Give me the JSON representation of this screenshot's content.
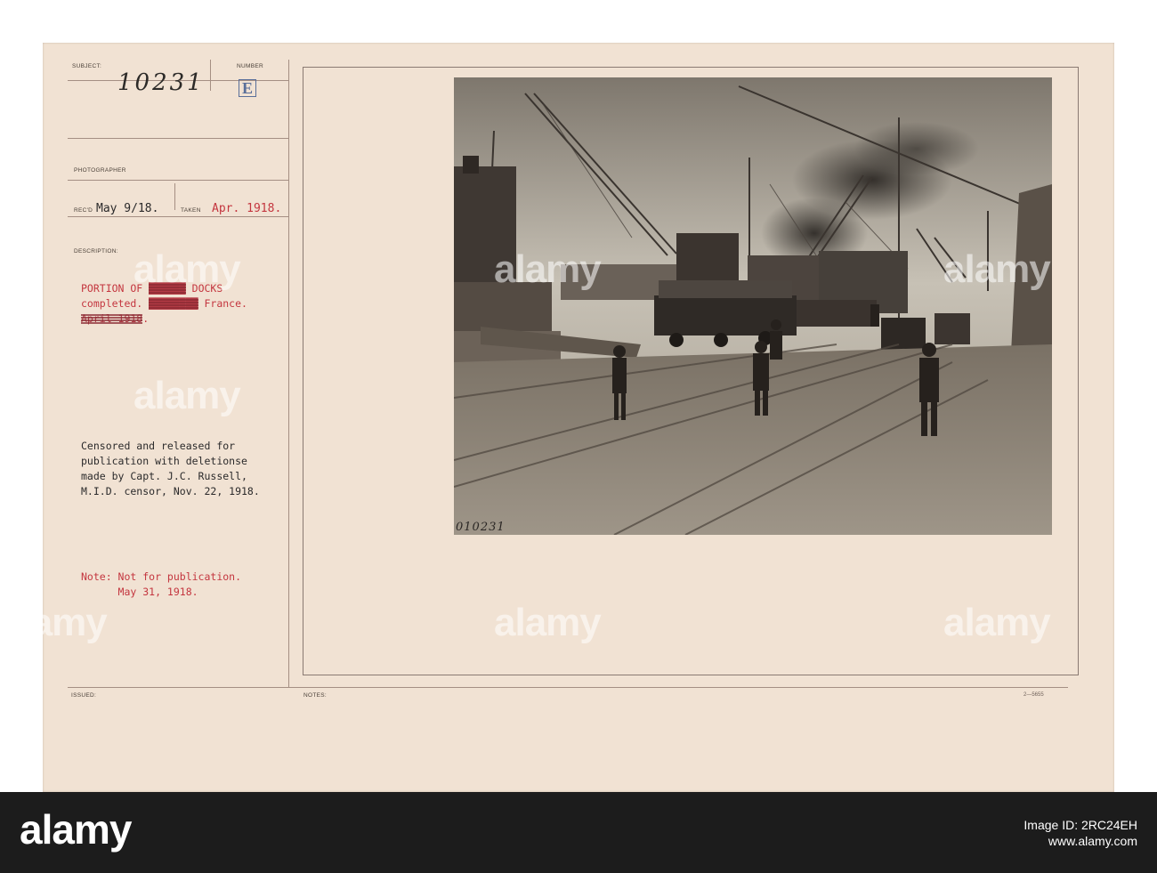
{
  "card": {
    "labels": {
      "subject": "SUBJECT:",
      "number": "NUMBER",
      "photographer": "PHOTOGRAPHER",
      "recd": "REC'D",
      "taken": "TAKEN",
      "description": "DESCRIPTION:",
      "issued": "ISSUED:",
      "notes": "NOTES:"
    },
    "subject_number": "10231",
    "number_letter": "E",
    "recd_date": "May 9/18.",
    "taken_date": "Apr. 1918.",
    "description": {
      "line1_prefix": "PORTION OF ",
      "line1_struck": "██████",
      "line1_suffix": " DOCKS",
      "line2_prefix": "completed. ",
      "line2_struck": "████████",
      "line2_suffix": " France.",
      "line3_struck": "April 1918",
      "line3_suffix": "."
    },
    "censor_text": "Censored and released for\npublication with deletionse\nmade by Capt. J.C. Russell,\nM.I.D. censor, Nov. 22, 1918.",
    "note_text": "Note: Not for publication.\n      May 31, 1918.",
    "photo_number": "010231",
    "form_code": "2—5655"
  },
  "watermarks": [
    "alamy",
    "alamy",
    "alamy",
    "alamy",
    "alamy",
    "alamy",
    "alamy"
  ],
  "footer": {
    "logo": "alamy",
    "image_id_label": "Image ID: 2RC24EH",
    "url": "www.alamy.com"
  }
}
